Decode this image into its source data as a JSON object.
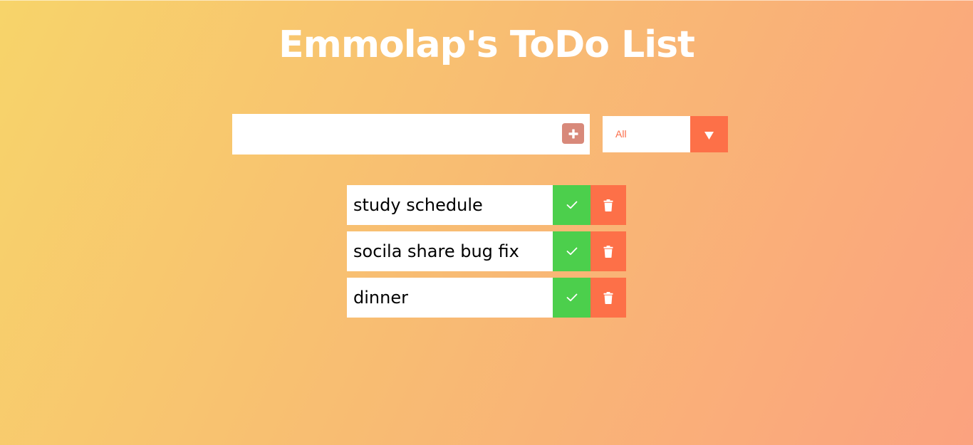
{
  "header": {
    "title": "Emmolap's ToDo List"
  },
  "form": {
    "input_value": "",
    "input_placeholder": "",
    "add_icon": "plus-square-icon",
    "filter": {
      "selected": "All",
      "toggle_icon": "caret-down-icon"
    }
  },
  "todos": [
    {
      "text": "study schedule"
    },
    {
      "text": "socila share bug fix"
    },
    {
      "text": "dinner"
    }
  ],
  "icons": {
    "complete": "check-icon",
    "delete": "trash-icon"
  },
  "colors": {
    "background_start": "#f7d46a",
    "background_end": "#fba27f",
    "accent": "#fd7048",
    "complete": "#4ccf4c",
    "add_button": "#d8897a",
    "title": "#ffffff"
  }
}
